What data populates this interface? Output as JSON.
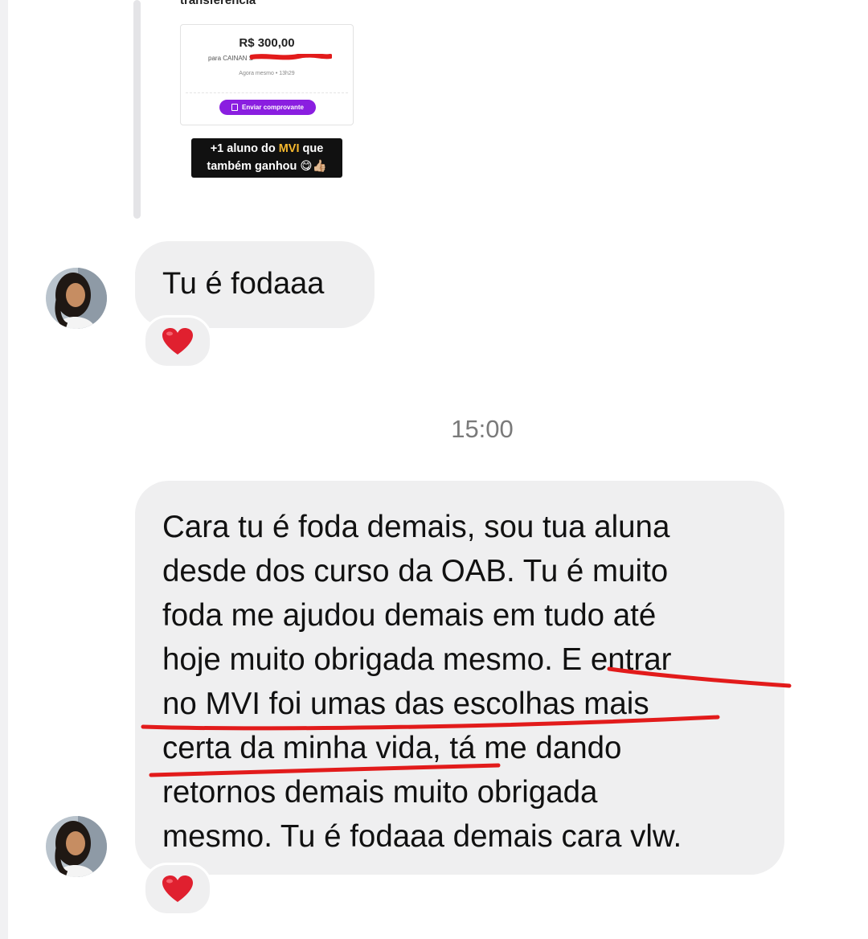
{
  "shared_story": {
    "top_text": "transferência",
    "receipt": {
      "amount": "R$ 300,00",
      "recipient": "para CAINAN S",
      "time": "Agora mesmo • 13h29",
      "button_label": "Enviar comprovante"
    },
    "caption": {
      "prefix": "+1 aluno do ",
      "highlight": "MVI",
      "suffix": " que",
      "line2": "também ganhou 😋👍🏼"
    }
  },
  "messages": [
    {
      "text": "Tu é fodaaa",
      "reaction": "heart-emoji"
    },
    {
      "lines": [
        "Cara tu é foda demais, sou tua aluna",
        "desde dos curso da OAB. Tu é muito",
        "foda me ajudou demais em tudo até",
        "hoje muito obrigada mesmo. E entrar",
        "no MVI foi umas das escolhas mais",
        "certa da minha vida, tá me dando",
        "retornos demais muito obrigada",
        "mesmo. Tu é fodaaa demais cara vlw."
      ],
      "reaction": "heart-emoji"
    }
  ],
  "timestamp": "15:00",
  "colors": {
    "bubble_background": "#efeff0",
    "annotation_red": "#e21b1b",
    "receipt_button": "#8a1ee0",
    "caption_highlight": "#f5b82e",
    "heart": "#e0202f"
  }
}
